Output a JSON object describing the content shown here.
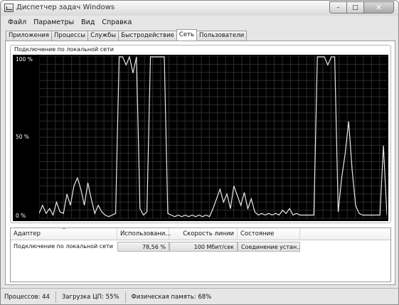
{
  "window": {
    "title": "Диспетчер задач Windows",
    "minimize": "–",
    "maximize": "□",
    "close": "✕"
  },
  "menu": [
    "Файл",
    "Параметры",
    "Вид",
    "Справка"
  ],
  "tabs": [
    {
      "label": "Приложения",
      "active": false
    },
    {
      "label": "Процессы",
      "active": false
    },
    {
      "label": "Службы",
      "active": false
    },
    {
      "label": "Быстродействие",
      "active": false
    },
    {
      "label": "Сеть",
      "active": true
    },
    {
      "label": "Пользователи",
      "active": false
    }
  ],
  "graph": {
    "title": "Подключение по локальной сети",
    "y_labels": [
      "100 %",
      "50 %",
      "0 %"
    ]
  },
  "chart_data": {
    "type": "line",
    "ylim": [
      0,
      100
    ],
    "grid": true,
    "x": [
      0,
      1,
      2,
      3,
      4,
      5,
      6,
      7,
      8,
      9,
      10,
      11,
      12,
      13,
      14,
      15,
      16,
      17,
      18,
      19,
      20,
      21,
      22,
      23,
      24,
      25,
      26,
      27,
      28,
      29,
      30,
      31,
      32,
      33,
      34,
      35,
      36,
      37,
      38,
      39,
      40,
      41,
      42,
      43,
      44,
      45,
      46,
      47,
      48,
      49,
      50,
      51,
      52,
      53,
      54,
      55,
      56,
      57,
      58,
      59,
      60,
      61,
      62,
      63,
      64,
      65,
      66,
      67,
      68,
      69,
      70,
      71,
      72,
      73,
      74,
      75,
      76,
      77,
      78,
      79,
      80,
      81,
      82,
      83,
      84,
      85,
      86,
      87,
      88,
      89,
      90,
      91,
      92,
      93,
      94,
      95,
      96,
      97,
      98,
      99,
      100
    ],
    "series": [
      {
        "values": [
          3,
          8,
          3,
          6,
          2,
          10,
          4,
          3,
          15,
          8,
          20,
          25,
          18,
          8,
          22,
          12,
          3,
          8,
          4,
          2,
          1,
          2,
          3,
          100,
          100,
          95,
          100,
          90,
          100,
          6,
          2,
          4,
          100,
          100,
          100,
          100,
          100,
          3,
          2,
          1,
          2,
          1,
          2,
          1,
          2,
          1,
          2,
          1,
          2,
          1,
          6,
          12,
          18,
          10,
          15,
          6,
          20,
          14,
          8,
          16,
          6,
          12,
          4,
          2,
          3,
          2,
          3,
          2,
          3,
          2,
          5,
          3,
          6,
          2,
          3,
          2,
          2,
          2,
          2,
          2,
          100,
          100,
          100,
          95,
          100,
          100,
          4,
          25,
          40,
          60,
          30,
          8,
          3,
          2,
          2,
          2,
          2,
          2,
          2,
          45,
          2
        ]
      }
    ]
  },
  "table": {
    "columns": [
      "Адаптер",
      "Использовани...",
      "Скорость линии",
      "Состояние"
    ],
    "rows": [
      {
        "adapter": "Подключение по локальной сети",
        "usage": "78,56 %",
        "speed": "100 Мбит/сек",
        "state": "Соединение устан..."
      }
    ]
  },
  "status": {
    "processes": "Процессов: 44",
    "cpu": "Загрузка ЦП: 55%",
    "memory": "Физическая память: 68%"
  }
}
